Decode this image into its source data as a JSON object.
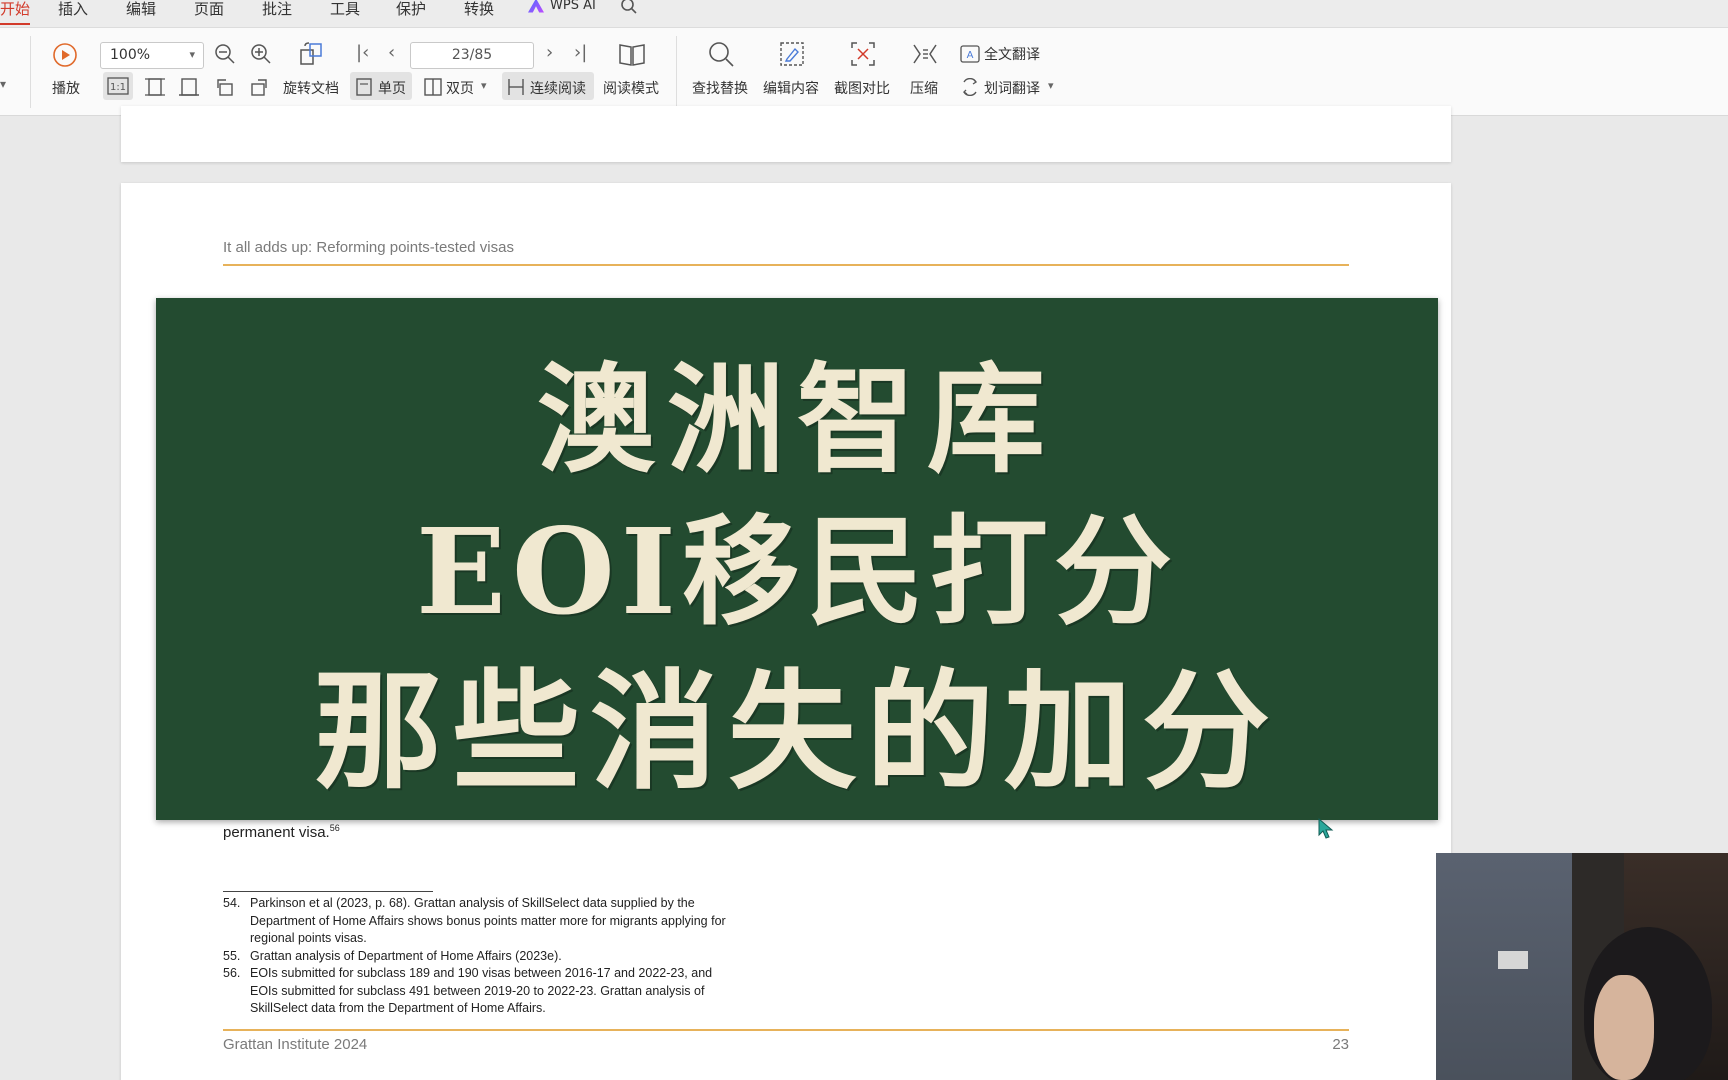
{
  "menu": {
    "items": [
      "开始",
      "插入",
      "编辑",
      "页面",
      "批注",
      "工具",
      "保护",
      "转换"
    ],
    "active_index": 0,
    "wps_ai_label": "WPS AI"
  },
  "toolbar": {
    "play_label": "播放",
    "zoom_value": "100%",
    "page_value": "23/85",
    "rotate_label": "旋转文档",
    "single_page_label": "单页",
    "double_page_label": "双页",
    "continuous_label": "连续阅读",
    "reading_mode_label": "阅读模式",
    "find_replace_label": "查找替换",
    "edit_content_label": "编辑内容",
    "screenshot_compare_label": "截图对比",
    "compress_label": "压缩",
    "full_translate_label": "全文翻译",
    "word_translate_label": "划词翻译"
  },
  "document": {
    "running_head": "It all adds up: Reforming points-tested visas",
    "body_text": "permanent visa.",
    "body_sup": "56",
    "footnotes": [
      {
        "num": "54.",
        "text": "Parkinson et al (2023, p. 68). Grattan analysis of SkillSelect data supplied by the Department of Home Affairs shows bonus points matter more for migrants applying for regional points visas."
      },
      {
        "num": "55.",
        "text": "Grattan analysis of Department of Home Affairs (2023e)."
      },
      {
        "num": "56.",
        "text": "EOIs submitted for subclass 189 and 190 visas between 2016-17 and 2022-23, and EOIs submitted for subclass 491 between 2019-20 to 2022-23. Grattan analysis of SkillSelect data from the Department of Home Affairs."
      }
    ],
    "footer_left": "Grattan Institute 2024",
    "footer_right": "23"
  },
  "banner": {
    "line1": "澳洲智库",
    "line2": "EOI移民打分",
    "line3": "那些消失的加分",
    "bg_color": "#234b30",
    "text_color": "#f0e8d0"
  },
  "colors": {
    "accent_red": "#d23a2a",
    "rule_gold": "#e7b25a"
  }
}
